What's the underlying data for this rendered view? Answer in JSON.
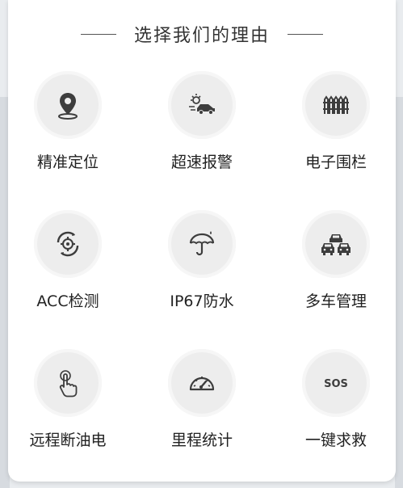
{
  "section": {
    "title": "选择我们的理由"
  },
  "features": [
    {
      "label": "精准定位",
      "icon": "location-pin-icon"
    },
    {
      "label": "超速报警",
      "icon": "speeding-car-icon"
    },
    {
      "label": "电子围栏",
      "icon": "fence-icon"
    },
    {
      "label": "ACC检测",
      "icon": "gear-cycle-icon"
    },
    {
      "label": "IP67防水",
      "icon": "umbrella-icon"
    },
    {
      "label": "多车管理",
      "icon": "multi-car-icon"
    },
    {
      "label": "远程断油电",
      "icon": "finger-touch-icon"
    },
    {
      "label": "里程统计",
      "icon": "speedometer-icon"
    },
    {
      "label": "一键求救",
      "icon": "sos-icon"
    }
  ],
  "sos_text": "SOS"
}
